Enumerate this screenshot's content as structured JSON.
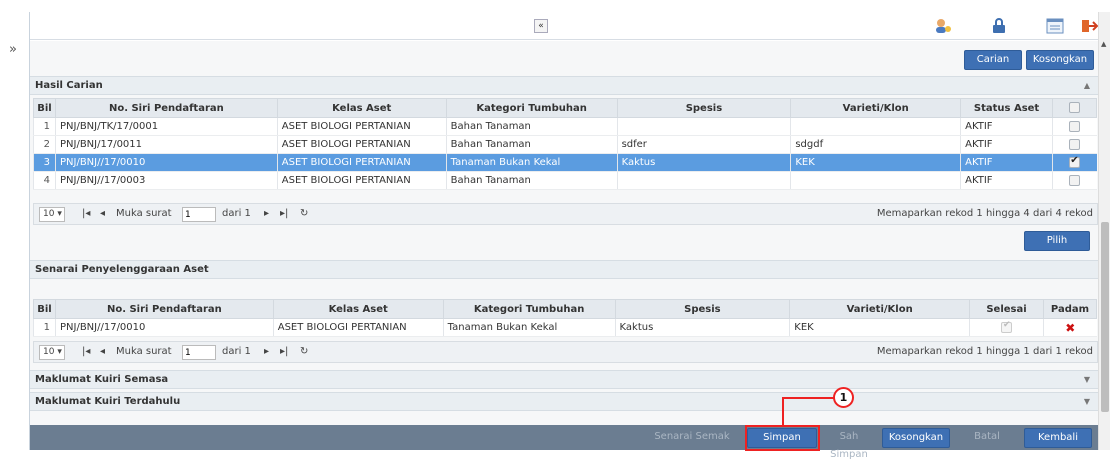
{
  "topbar": {
    "collapse_glyph": "«",
    "icons": [
      "user-icon",
      "lock-icon",
      "list-icon",
      "logout-icon"
    ]
  },
  "search_buttons": {
    "search": "Carian",
    "clear": "Kosongkan"
  },
  "results": {
    "title": "Hasil Carian",
    "columns": [
      "Bil",
      "No. Siri Pendaftaran",
      "Kelas Aset",
      "Kategori Tumbuhan",
      "Spesis",
      "Varieti/Klon",
      "Status Aset"
    ],
    "rows": [
      {
        "bil": "1",
        "no_siri": "PNJ/BNJ/TK/17/0001",
        "kelas": "ASET BIOLOGI PERTANIAN",
        "kategori": "Bahan Tanaman",
        "spesis": "",
        "varieti": "",
        "status": "AKTIF",
        "checked": false,
        "selected": false
      },
      {
        "bil": "2",
        "no_siri": "PNJ/BNJ/17/0011",
        "kelas": "ASET BIOLOGI PERTANIAN",
        "kategori": "Bahan Tanaman",
        "spesis": "sdfer",
        "varieti": "sdgdf",
        "status": "AKTIF",
        "checked": false,
        "selected": false
      },
      {
        "bil": "3",
        "no_siri": "PNJ/BNJ//17/0010",
        "kelas": "ASET BIOLOGI PERTANIAN",
        "kategori": "Tanaman Bukan Kekal",
        "spesis": "Kaktus",
        "varieti": "KEK",
        "status": "AKTIF",
        "checked": true,
        "selected": true
      },
      {
        "bil": "4",
        "no_siri": "PNJ/BNJ//17/0003",
        "kelas": "ASET BIOLOGI PERTANIAN",
        "kategori": "Bahan Tanaman",
        "spesis": "",
        "varieti": "",
        "status": "AKTIF",
        "checked": false,
        "selected": false
      }
    ],
    "pager": {
      "page_size": "10 ▾",
      "page_label": "Muka surat",
      "page": "1",
      "of_label": "dari 1",
      "summary": "Memaparkan rekod 1 hingga 4 dari 4 rekod"
    },
    "select_button": "Pilih"
  },
  "maintenance": {
    "title": "Senarai Penyelenggaraan Aset",
    "columns": [
      "Bil",
      "No. Siri Pendaftaran",
      "Kelas Aset",
      "Kategori Tumbuhan",
      "Spesis",
      "Varieti/Klon",
      "Selesai",
      "Padam"
    ],
    "rows": [
      {
        "bil": "1",
        "no_siri": "PNJ/BNJ//17/0010",
        "kelas": "ASET BIOLOGI PERTANIAN",
        "kategori": "Tanaman Bukan Kekal",
        "spesis": "Kaktus",
        "varieti": "KEK",
        "selesai": true,
        "delete_glyph": "✖"
      }
    ],
    "pager": {
      "page_size": "10 ▾",
      "page_label": "Muka surat",
      "page": "1",
      "of_label": "dari 1",
      "summary": "Memaparkan rekod 1 hingga 1 dari 1 rekod"
    }
  },
  "sections": {
    "current_query": "Maklumat Kuiri Semasa",
    "previous_query": "Maklumat Kuiri Terdahulu"
  },
  "footer_buttons": {
    "checklist": "Senarai Semak",
    "save": "Simpan",
    "confirm_save": "Sah Simpan",
    "clear": "Kosongkan",
    "cancel": "Batal",
    "back": "Kembali"
  },
  "pager_glyphs": {
    "first": "|◂",
    "prev": "◂",
    "next": "▸",
    "last": "▸|",
    "refresh": "↻"
  },
  "callout": {
    "number": "1"
  },
  "colors": {
    "primary": "#3e70b4",
    "selected_row": "#5b9ce0",
    "footer": "#6b7d91",
    "callout": "#e22222",
    "delete": "#cc1111"
  }
}
